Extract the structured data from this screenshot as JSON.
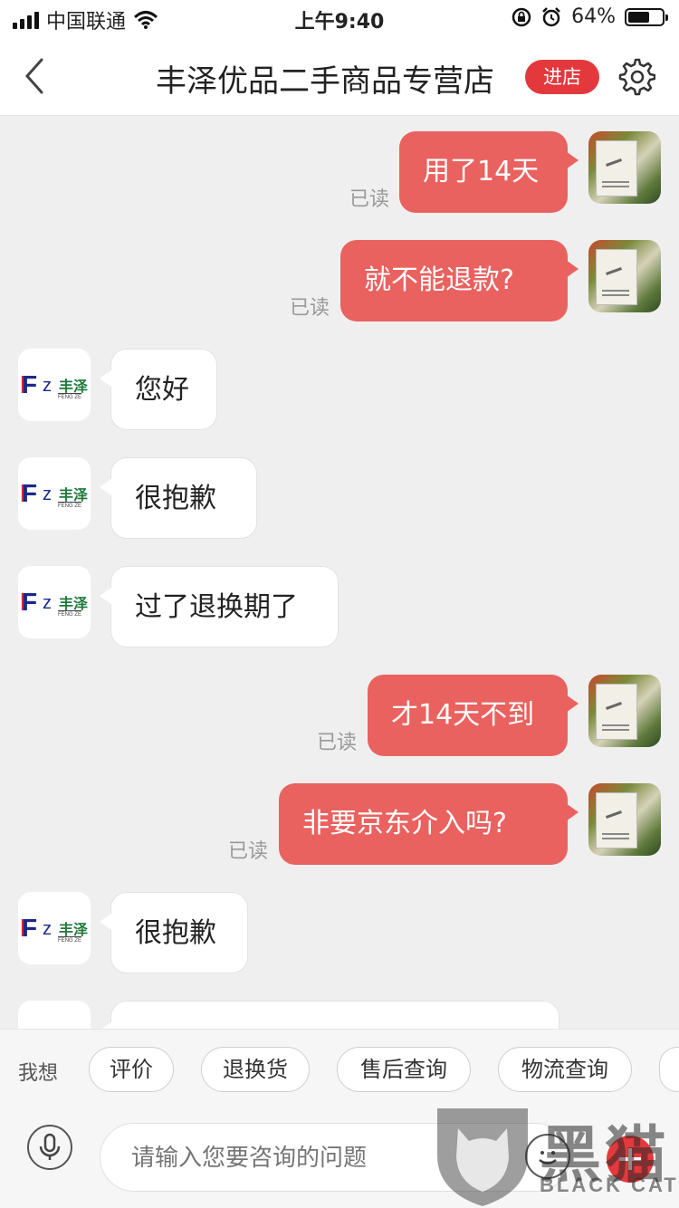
{
  "status_bar": {
    "carrier": "中国联通",
    "time": "上午9:40",
    "battery": "64%",
    "battery_level": 0.64
  },
  "header": {
    "title": "丰泽优品二手商品专营店",
    "enter_store": "进店"
  },
  "shop_logo": {
    "brand_cn": "丰泽",
    "brand_en": "FENG ZE"
  },
  "messages": [
    {
      "from": "me",
      "text": "用了14天",
      "status": "已读"
    },
    {
      "from": "me",
      "text": "就不能退款?",
      "status": "已读"
    },
    {
      "from": "shop",
      "text": "您好"
    },
    {
      "from": "shop",
      "text": "很抱歉"
    },
    {
      "from": "shop",
      "text": "过了退换期了"
    },
    {
      "from": "me",
      "text": "才14天不到",
      "status": "已读"
    },
    {
      "from": "me",
      "text": "非要京东介入吗?",
      "status": "已读"
    },
    {
      "from": "shop",
      "text": "很抱歉"
    }
  ],
  "quick_bar": {
    "label": "我想",
    "chips": [
      "评价",
      "退换货",
      "售后查询",
      "物流查询"
    ]
  },
  "input": {
    "placeholder": "请输入您要咨询的问题"
  },
  "watermark": {
    "cn": "黑猫",
    "en": "BLACK CAT"
  },
  "colors": {
    "accent": "#e4393c",
    "bubble_out": "#e9625f",
    "background": "#efefef"
  }
}
